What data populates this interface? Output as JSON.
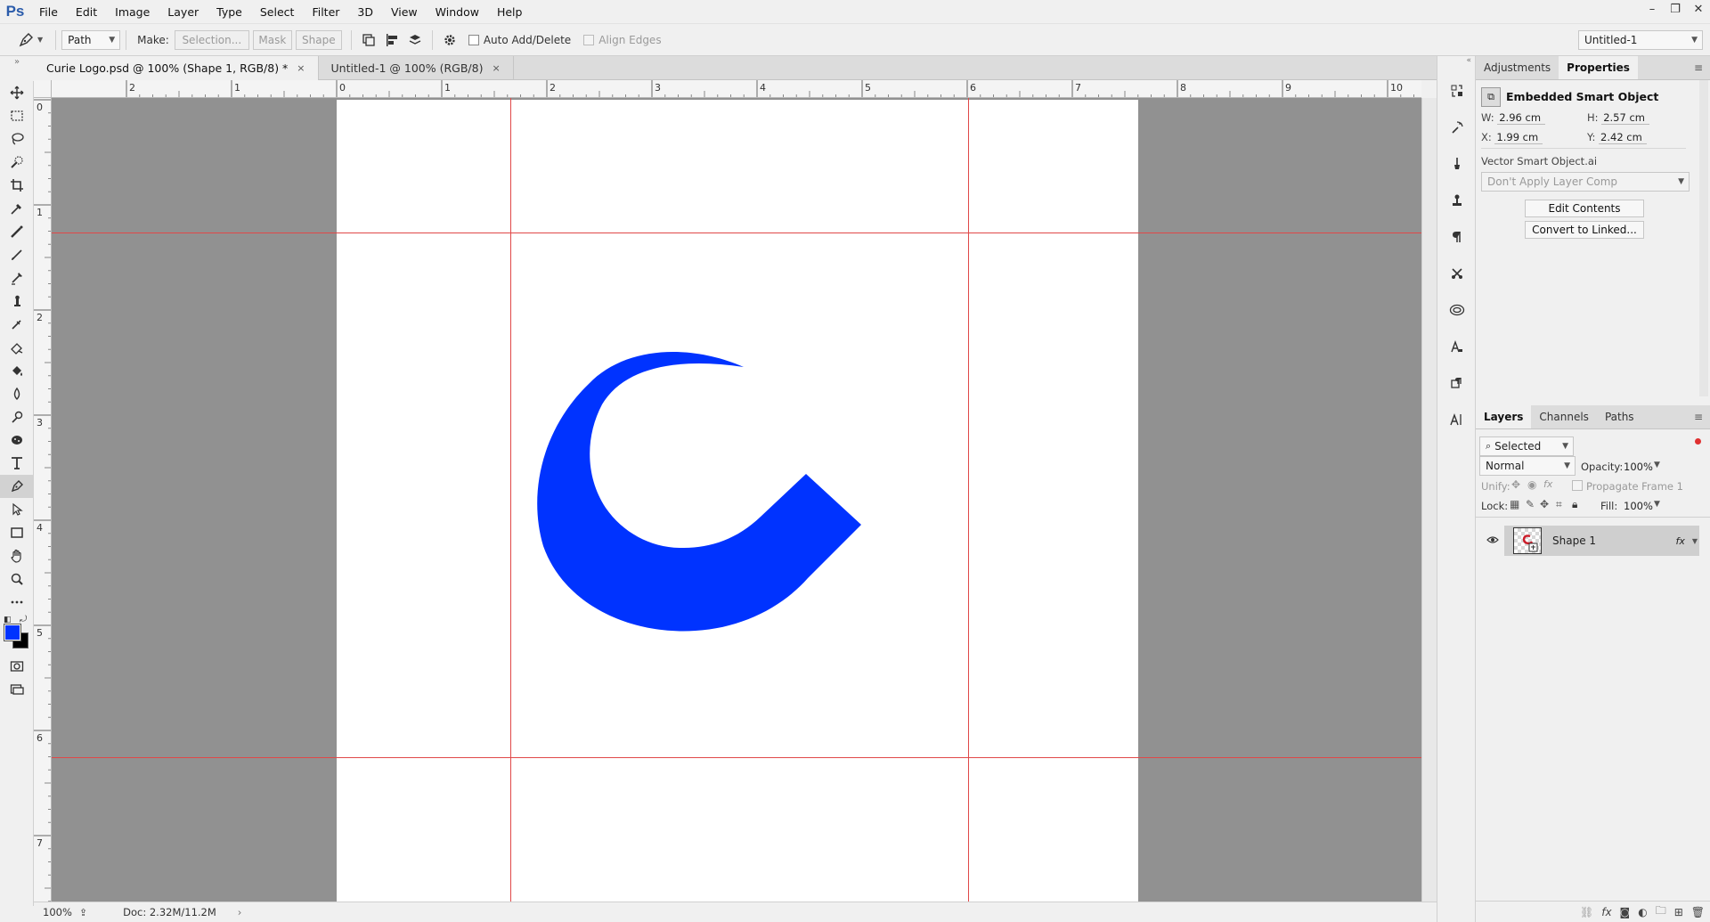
{
  "app": {
    "logo": "Ps"
  },
  "menu": [
    "File",
    "Edit",
    "Image",
    "Layer",
    "Type",
    "Select",
    "Filter",
    "3D",
    "View",
    "Window",
    "Help"
  ],
  "window_controls": [
    "–",
    "❐",
    "✕"
  ],
  "options": {
    "mode": "Path",
    "make_label": "Make:",
    "selection_btn": "Selection...",
    "mask_btn": "Mask",
    "shape_btn": "Shape",
    "auto_add_delete": "Auto Add/Delete",
    "align_edges": "Align Edges",
    "workspace": "Untitled-1"
  },
  "tabs": [
    {
      "label": "Curie Logo.psd @ 100% (Shape 1, RGB/8) *",
      "close": "×"
    },
    {
      "label": "Untitled-1 @ 100% (RGB/8)",
      "close": "×"
    }
  ],
  "ruler": {
    "h_labels": [
      "2",
      "1",
      "0",
      "1",
      "2",
      "3",
      "4",
      "5",
      "6",
      "7",
      "8",
      "9",
      "10"
    ],
    "v_labels": [
      "0",
      "1",
      "2",
      "3",
      "4",
      "5",
      "6",
      "7"
    ]
  },
  "artwork": {
    "fill_color": "#0033ff"
  },
  "status": {
    "zoom": "100%",
    "doc": "Doc: 2.32M/11.2M",
    "arrow": "›"
  },
  "properties": {
    "tabs": [
      "Adjustments",
      "Properties"
    ],
    "title": "Embedded Smart Object",
    "w_label": "W:",
    "w": "2.96 cm",
    "h_label": "H:",
    "h": "2.57 cm",
    "x_label": "X:",
    "x": "1.99 cm",
    "y_label": "Y:",
    "y": "2.42 cm",
    "file": "Vector Smart Object.ai",
    "layer_comp": "Don't Apply Layer Comp",
    "edit_contents": "Edit Contents",
    "convert": "Convert to Linked..."
  },
  "layers": {
    "tabs": [
      "Layers",
      "Channels",
      "Paths"
    ],
    "filter": "Selected",
    "blend": "Normal",
    "opacity_label": "Opacity:",
    "opacity": "100%",
    "unify_label": "Unify:",
    "propagate": "Propagate Frame 1",
    "lock_label": "Lock:",
    "fill_label": "Fill:",
    "fill": "100%",
    "items": [
      {
        "name": "Shape 1",
        "fx": "fx"
      }
    ]
  }
}
